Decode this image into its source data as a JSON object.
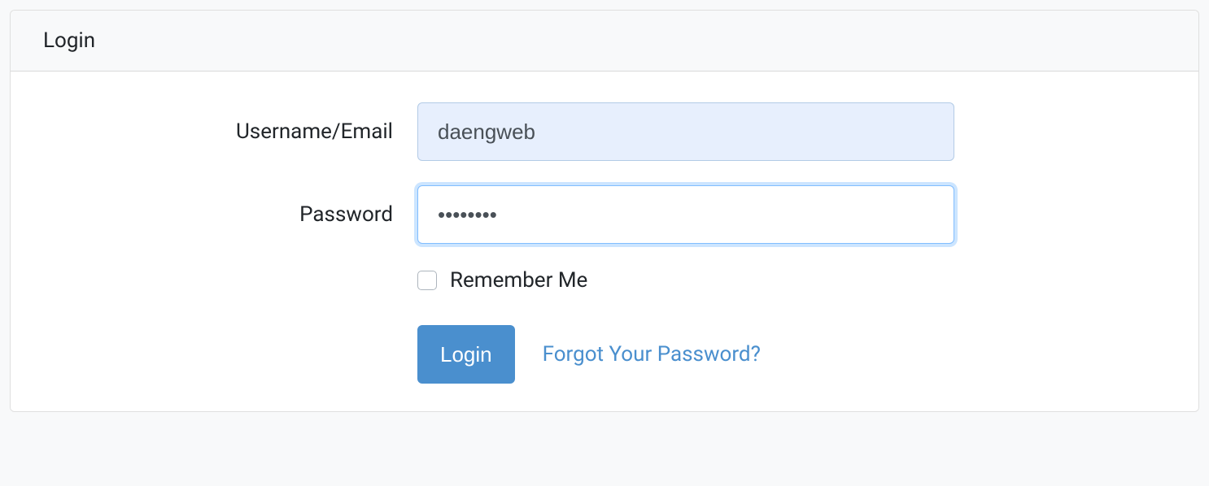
{
  "card": {
    "title": "Login"
  },
  "form": {
    "username": {
      "label": "Username/Email",
      "value": "daengweb"
    },
    "password": {
      "label": "Password",
      "value": "••••••••"
    },
    "remember": {
      "label": "Remember Me",
      "checked": false
    },
    "submit_label": "Login",
    "forgot_link": "Forgot Your Password?"
  }
}
